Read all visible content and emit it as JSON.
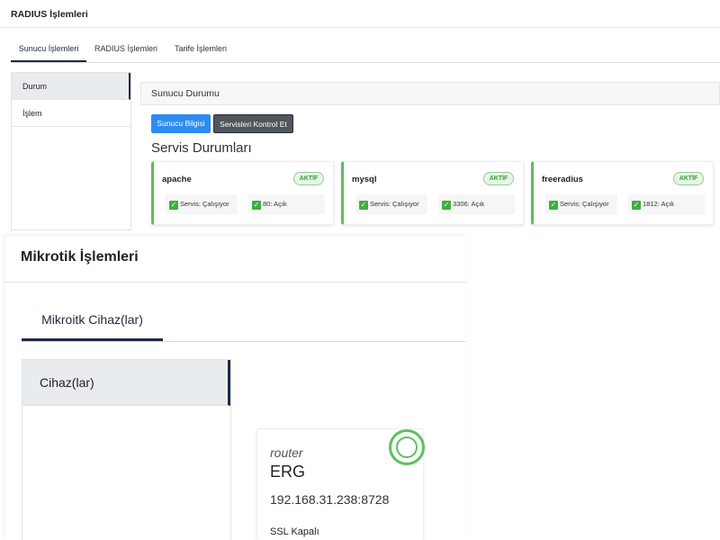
{
  "radius": {
    "title": "RADIUS İşlemleri",
    "tabs": [
      "Sunucu İşlemleri",
      "RADIUS İşlemleri",
      "Tarife İşlemleri"
    ],
    "sidebar": [
      "Durum",
      "İşlem"
    ],
    "card_title": "Sunucu Durumu",
    "buttons": {
      "info": "Sunucu Bilgisi",
      "check": "Servisleri Kontrol Et"
    },
    "services_title": "Servis Durumları",
    "services": [
      {
        "name": "apache",
        "badge": "AKTİF",
        "status": "Servis: Çalışıyor",
        "port": "80: Açık"
      },
      {
        "name": "mysql",
        "badge": "AKTİF",
        "status": "Servis: Çalışıyor",
        "port": "3306: Açık"
      },
      {
        "name": "freeradius",
        "badge": "AKTİF",
        "status": "Servis: Çalışıyor",
        "port": "1812: Açık"
      }
    ]
  },
  "mikrotik": {
    "title": "Mikrotik İşlemleri",
    "tab": "Mikroitk Cihaz(lar)",
    "sidebar": [
      "Cihaz(lar)"
    ],
    "device": {
      "type": "router",
      "name": "ERG",
      "address": "192.168.31.238:8728",
      "ssl": "SSL Kapalı"
    }
  },
  "colors": {
    "accent_dark": "#1d2a44",
    "primary_button": "#2e8cf0",
    "dark_button": "#4f565c",
    "success": "#5bbf5b",
    "badge_text": "#3b9a3b"
  }
}
